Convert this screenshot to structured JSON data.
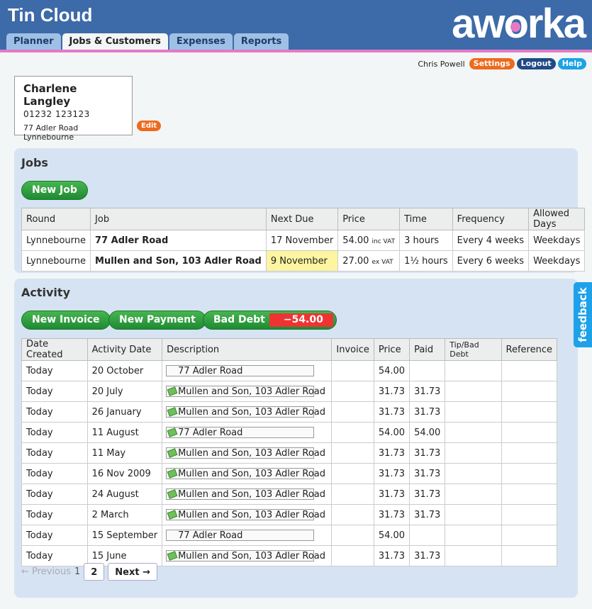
{
  "app": {
    "title": "Tin Cloud",
    "logo": "aworka"
  },
  "tabs": [
    {
      "label": "Planner",
      "active": false
    },
    {
      "label": "Jobs & Customers",
      "active": true
    },
    {
      "label": "Expenses",
      "active": false
    },
    {
      "label": "Reports",
      "active": false
    }
  ],
  "userbar": {
    "user": "Chris Powell",
    "settings": "Settings",
    "logout": "Logout",
    "help": "Help"
  },
  "customer": {
    "name": "Charlene Langley",
    "phone": "01232 123123",
    "address_line1": "77 Adler Road",
    "address_line2": "Lynnebourne",
    "edit_label": "Edit"
  },
  "jobs": {
    "heading": "Jobs",
    "new_job_label": "New Job",
    "columns": [
      "Round",
      "Job",
      "Next Due",
      "Price",
      "Time",
      "Frequency",
      "Allowed Days"
    ],
    "rows": [
      {
        "round": "Lynnebourne",
        "job": "77 Adler Road",
        "next_due": "17 November",
        "price": "54.00",
        "vat": "inc VAT",
        "time": "3 hours",
        "frequency": "Every 4 weeks",
        "days": "Weekdays",
        "highlight": false
      },
      {
        "round": "Lynnebourne",
        "job": "Mullen and Son, 103 Adler Road",
        "next_due": "9 November",
        "price": "27.00",
        "vat": "ex VAT",
        "time": "1½ hours",
        "frequency": "Every 6 weeks",
        "days": "Weekdays",
        "highlight": true
      }
    ]
  },
  "activity": {
    "heading": "Activity",
    "new_invoice_label": "New Invoice",
    "new_payment_label": "New Payment",
    "bad_debt_label": "Bad Debt",
    "bad_debt_amount": "−54.00",
    "columns": [
      "Date Created",
      "Activity Date",
      "Description",
      "Invoice",
      "Price",
      "Paid",
      "Tip/Bad Debt",
      "Reference"
    ],
    "rows": [
      {
        "created": "Today",
        "date": "20 October",
        "desc": "77 Adler Road",
        "paid_icon": false,
        "invoice": "",
        "price": "54.00",
        "paid": "",
        "tip": "",
        "ref": ""
      },
      {
        "created": "Today",
        "date": "20 July",
        "desc": "Mullen and Son, 103 Adler Road",
        "paid_icon": true,
        "invoice": "",
        "price": "31.73",
        "paid": "31.73",
        "tip": "",
        "ref": ""
      },
      {
        "created": "Today",
        "date": "26 January",
        "desc": "Mullen and Son, 103 Adler Road",
        "paid_icon": true,
        "invoice": "",
        "price": "31.73",
        "paid": "31.73",
        "tip": "",
        "ref": ""
      },
      {
        "created": "Today",
        "date": "11 August",
        "desc": "77 Adler Road",
        "paid_icon": true,
        "invoice": "",
        "price": "54.00",
        "paid": "54.00",
        "tip": "",
        "ref": ""
      },
      {
        "created": "Today",
        "date": "11 May",
        "desc": "Mullen and Son, 103 Adler Road",
        "paid_icon": true,
        "invoice": "",
        "price": "31.73",
        "paid": "31.73",
        "tip": "",
        "ref": ""
      },
      {
        "created": "Today",
        "date": "16 Nov 2009",
        "desc": "Mullen and Son, 103 Adler Road",
        "paid_icon": true,
        "invoice": "",
        "price": "31.73",
        "paid": "31.73",
        "tip": "",
        "ref": ""
      },
      {
        "created": "Today",
        "date": "24 August",
        "desc": "Mullen and Son, 103 Adler Road",
        "paid_icon": true,
        "invoice": "",
        "price": "31.73",
        "paid": "31.73",
        "tip": "",
        "ref": ""
      },
      {
        "created": "Today",
        "date": "2 March",
        "desc": "Mullen and Son, 103 Adler Road",
        "paid_icon": true,
        "invoice": "",
        "price": "31.73",
        "paid": "31.73",
        "tip": "",
        "ref": ""
      },
      {
        "created": "Today",
        "date": "15 September",
        "desc": "77 Adler Road",
        "paid_icon": false,
        "invoice": "",
        "price": "54.00",
        "paid": "",
        "tip": "",
        "ref": ""
      },
      {
        "created": "Today",
        "date": "15 June",
        "desc": "Mullen and Son, 103 Adler Road",
        "paid_icon": true,
        "invoice": "",
        "price": "31.73",
        "paid": "31.73",
        "tip": "",
        "ref": ""
      }
    ]
  },
  "pagination": {
    "previous": "← Previous",
    "current": "1",
    "page2": "2",
    "next": "Next →"
  },
  "feedback": {
    "label": "feedback"
  },
  "colors": {
    "header": "#3d6aa8",
    "stripe": "#e47ac7",
    "panel": "#d6e3f2",
    "green": "#1f8a33",
    "orange": "#ee6a1d",
    "highlight": "#fdf5a0"
  }
}
